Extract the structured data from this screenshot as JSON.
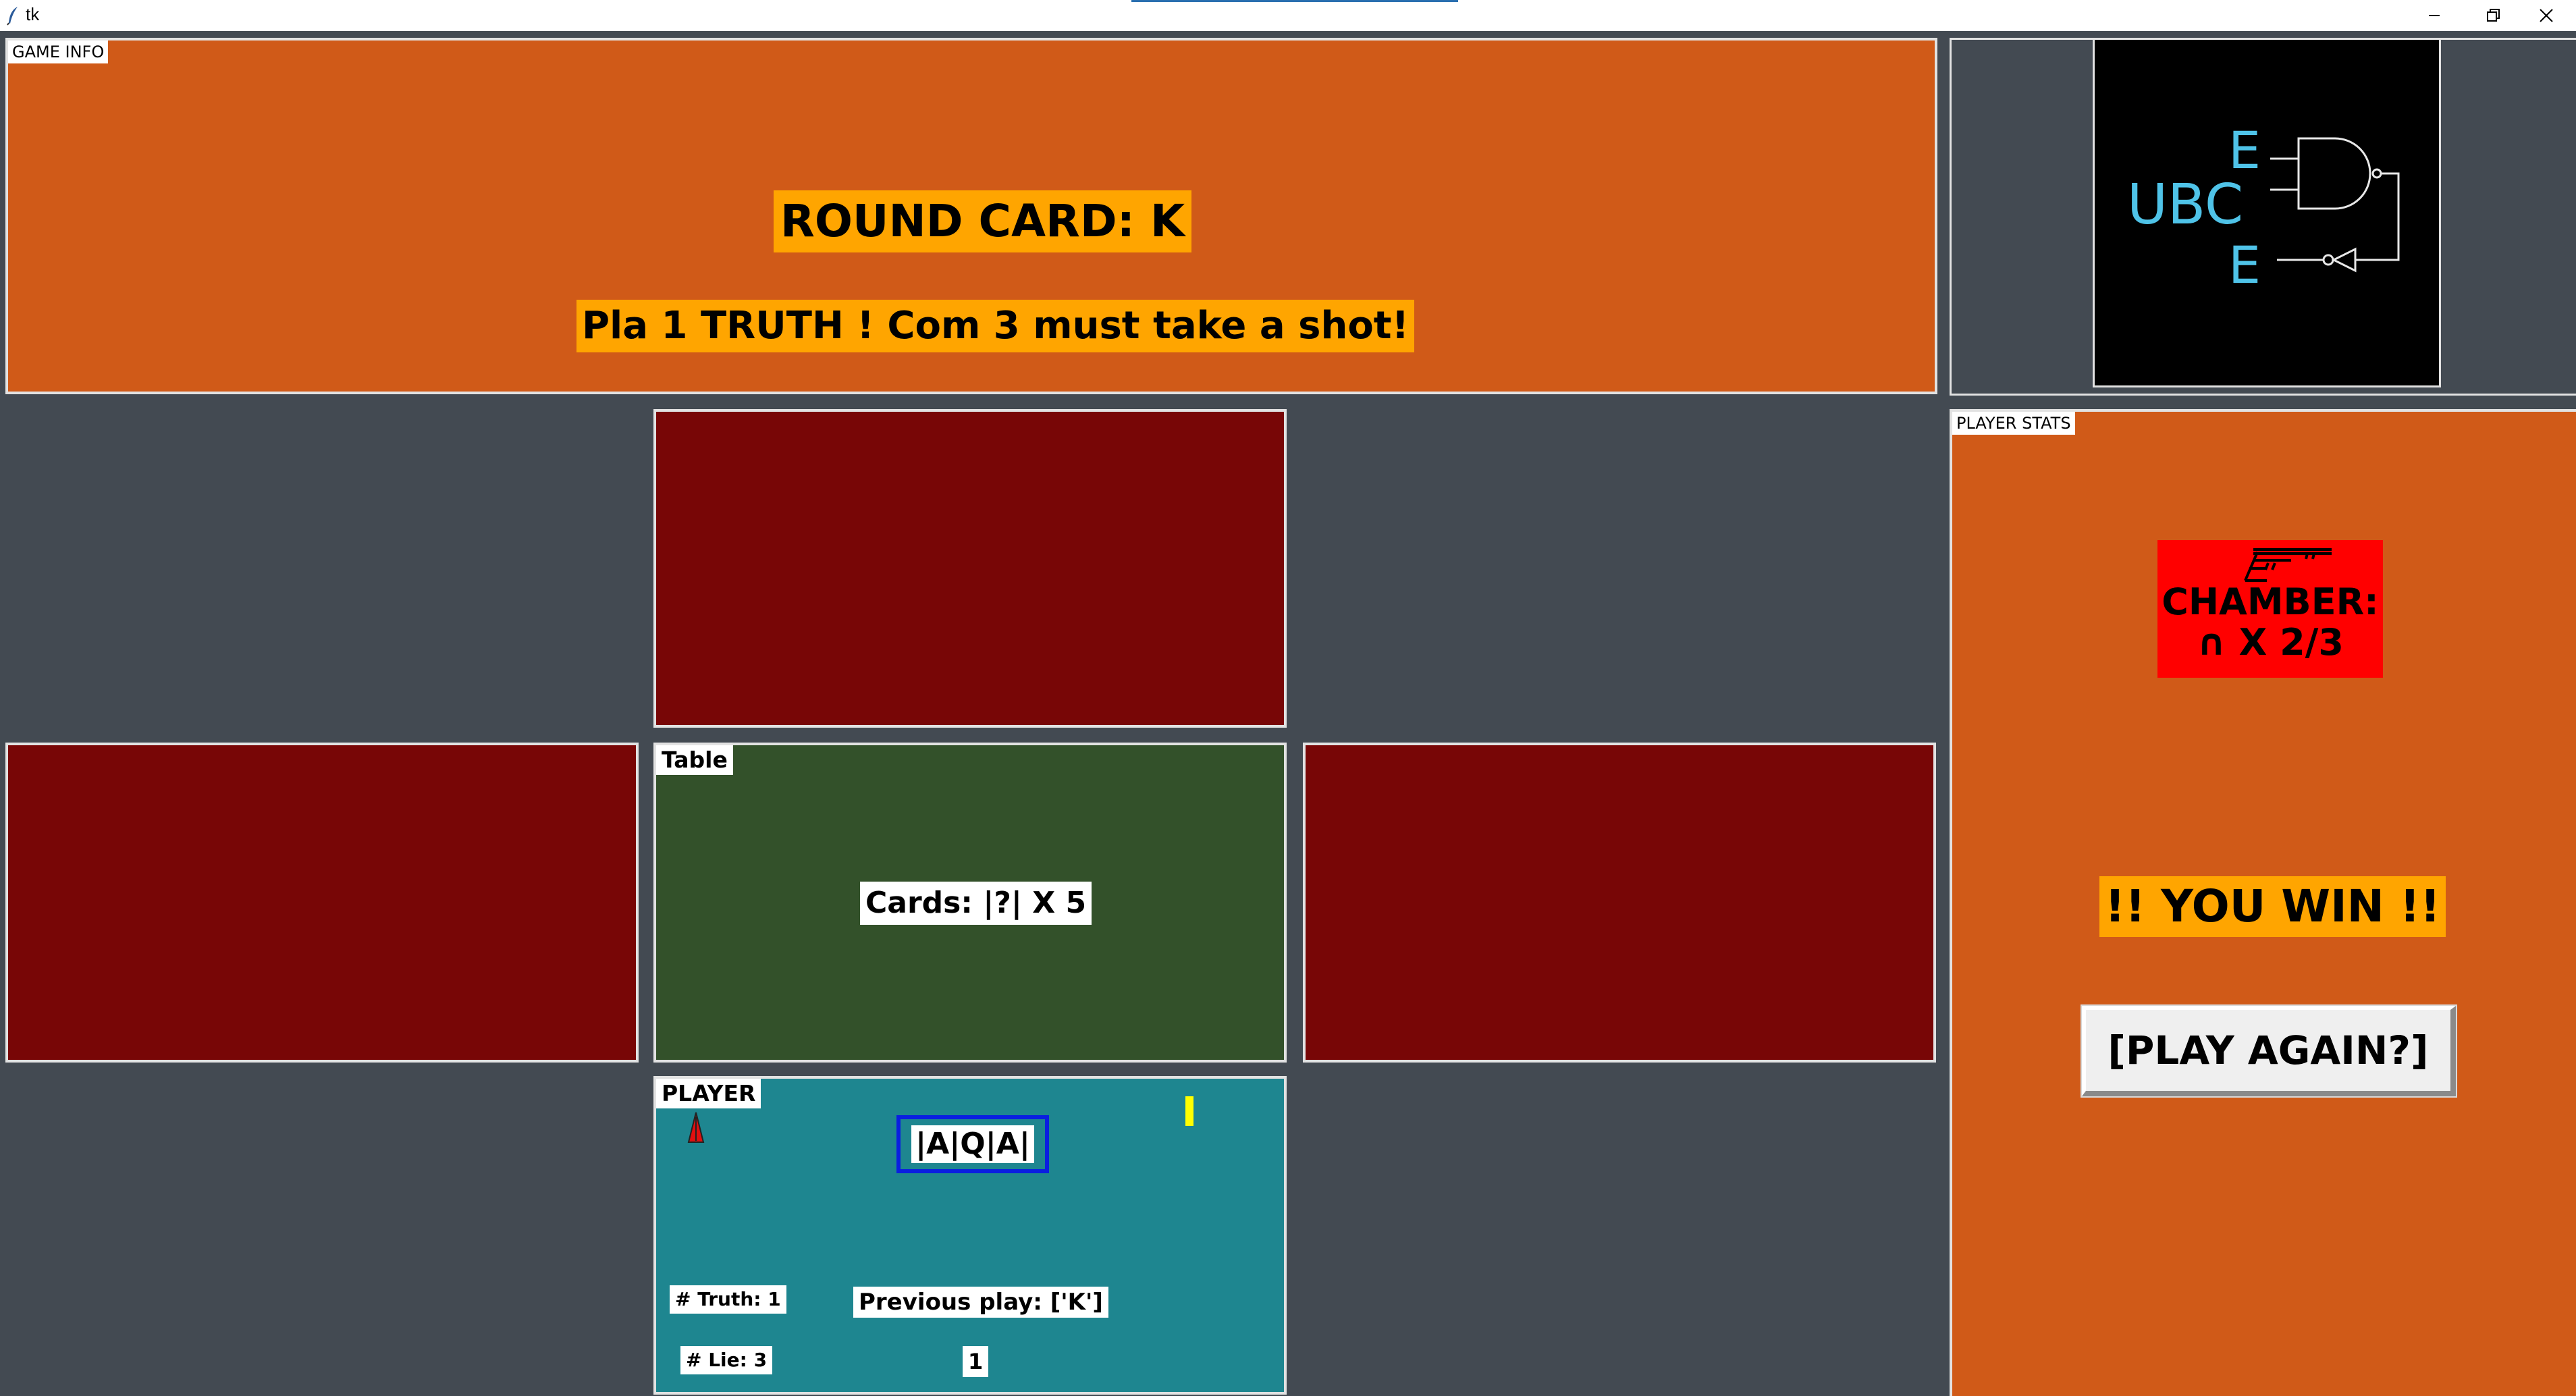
{
  "window": {
    "title": "tk",
    "app_icon": "feather-icon",
    "controls": [
      "minimize-icon",
      "restore-icon",
      "close-icon"
    ]
  },
  "game_info": {
    "label": "GAME INFO",
    "round_card": "ROUND CARD: K",
    "status": "Pla 1 TRUTH ! Com 3 must take a shot!"
  },
  "logo": {
    "name": "UBCE-logo",
    "text_top": "E",
    "text_mid": "UBC",
    "text_bottom": "E",
    "color": "#4fc3e8"
  },
  "table": {
    "label": "Table",
    "cards": "Cards: |?| X 5"
  },
  "player": {
    "label": "PLAYER",
    "hand": "|A|Q|A|",
    "truth_count": "# Truth: 1",
    "lie_count": "# Lie: 3",
    "previous_play": "Previous play: ['K']",
    "play_number": "1",
    "marker_icon": "red-cone-icon"
  },
  "player_stats": {
    "label": "PLAYER STATS",
    "gun_icon": "revolver-icon",
    "chamber_label": "CHAMBER:",
    "chamber_value": "∩ X 2/3",
    "win_text": "!! YOU WIN !!",
    "play_again": "[PLAY AGAIN?]"
  },
  "colors": {
    "background": "#434a52",
    "panel_orange": "#d05a18",
    "highlight_orange": "#ffa500",
    "opponent_red": "#780606",
    "table_green": "#33512a",
    "player_teal": "#1e8690",
    "chamber_red": "#ff0000",
    "hand_border_blue": "#0a1ee0"
  }
}
